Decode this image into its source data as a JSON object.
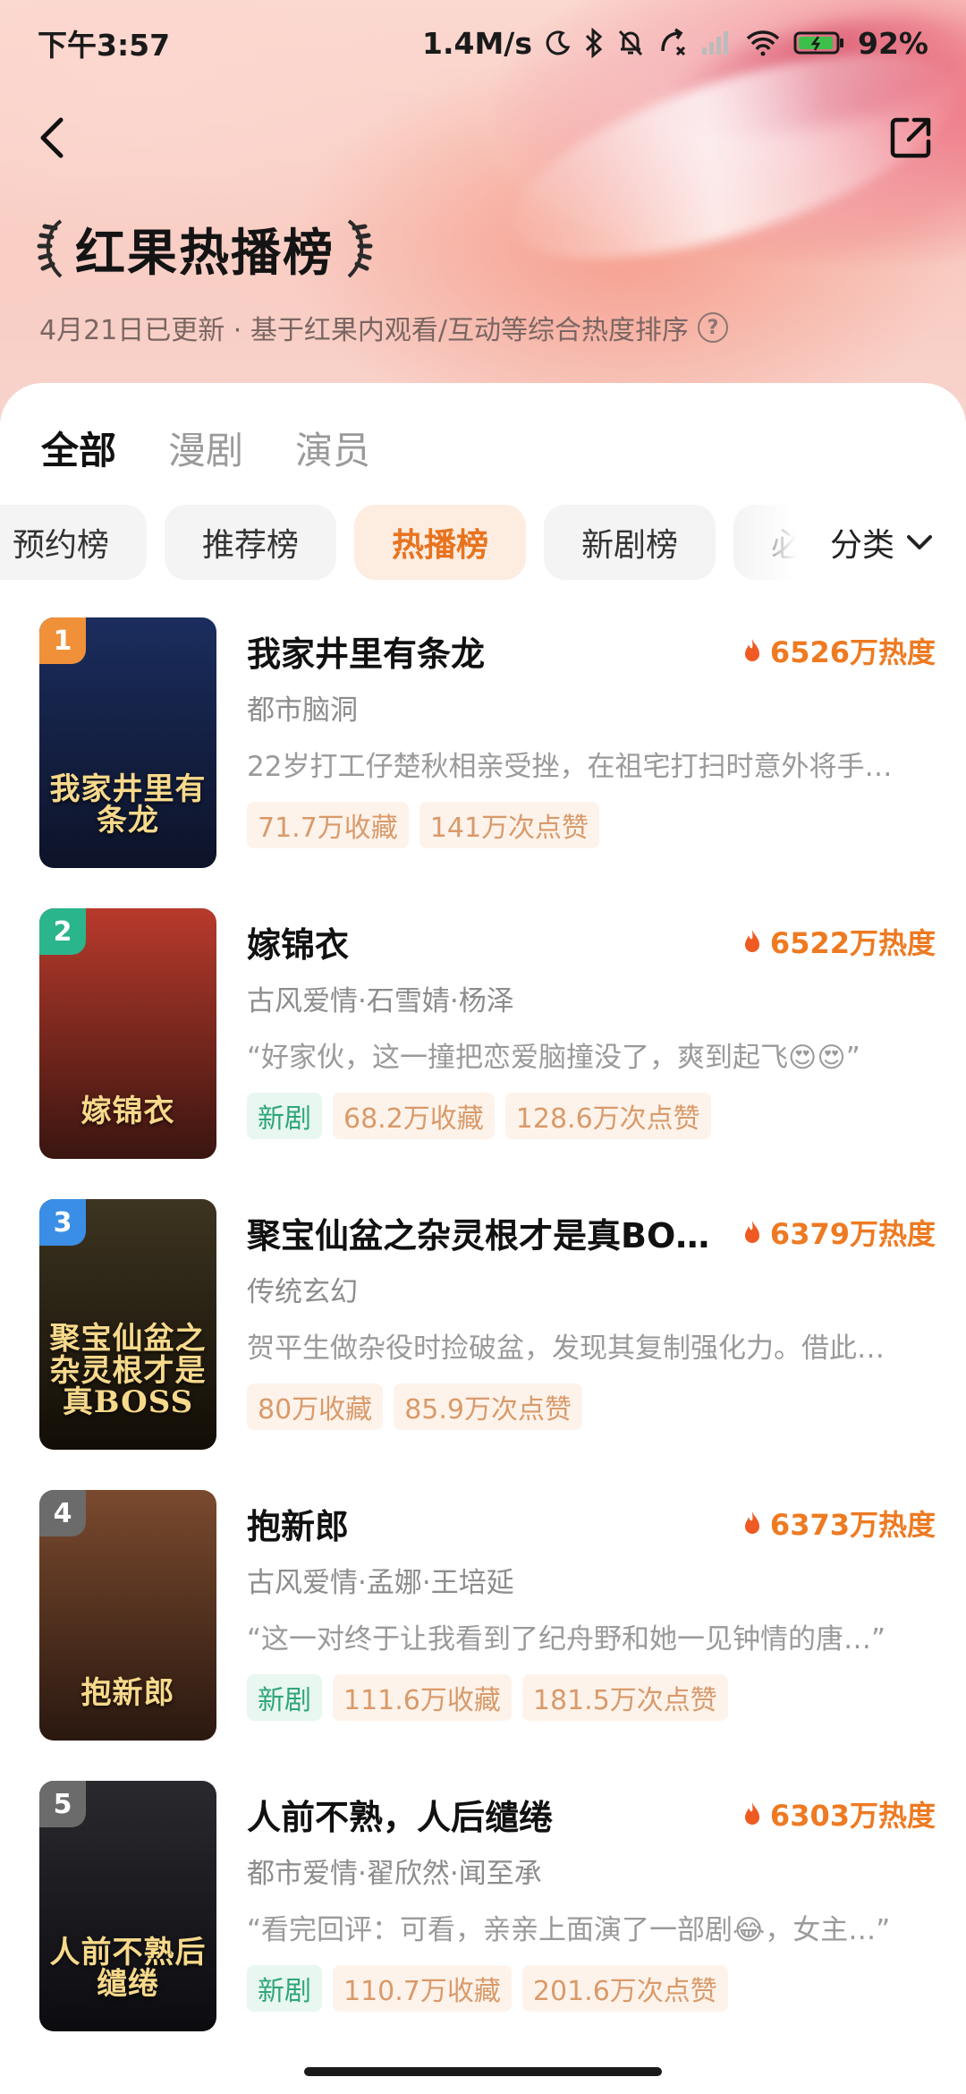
{
  "status_bar": {
    "time": "下午3:57",
    "net_speed": "1.4M/s",
    "battery": "92%"
  },
  "header": {
    "title": "红果热播榜",
    "subtitle": "4月21日已更新 · 基于红果内观看/互动等综合热度排序"
  },
  "tabs": [
    "全部",
    "漫剧",
    "演员"
  ],
  "active_tab": "全部",
  "chips": [
    "预约榜",
    "推荐榜",
    "热播榜",
    "新剧榜",
    "必"
  ],
  "active_chip": "热播榜",
  "category_label": "分类",
  "items": [
    {
      "rank": "1",
      "title": "我家井里有条龙",
      "heat": "6526万热度",
      "genre": "都市脑洞",
      "desc": "22岁打工仔楚秋相亲受挫，在祖宅打扫时意外将手…",
      "tags": [
        "71.7万收藏",
        "141万次点赞"
      ],
      "is_new": false,
      "new_label": "",
      "poster_text": "我家井里有条龙",
      "colors": {
        "rank": "#f0913a",
        "poster_top": "#1b2d5e",
        "poster_bottom": "#0d1328"
      }
    },
    {
      "rank": "2",
      "title": "嫁锦衣",
      "heat": "6522万热度",
      "genre": "古风爱情·石雪婧·杨泽",
      "desc": "“好家伙，这一撞把恋爱脑撞没了，爽到起飞😍😍”",
      "tags": [
        "68.2万收藏",
        "128.6万次点赞"
      ],
      "is_new": true,
      "new_label": "新剧",
      "poster_text": "嫁锦衣",
      "colors": {
        "rank": "#2ab58c",
        "poster_top": "#b83a2c",
        "poster_bottom": "#3a1510"
      }
    },
    {
      "rank": "3",
      "title": "聚宝仙盆之杂灵根才是真BOSS",
      "heat": "6379万热度",
      "genre": "传统玄幻",
      "desc": "贺平生做杂役时捡破盆，发现其复制强化力。借此…",
      "tags": [
        "80万收藏",
        "85.9万次点赞"
      ],
      "is_new": false,
      "new_label": "",
      "poster_text": "聚宝仙盆之杂灵根才是真BOSS",
      "colors": {
        "rank": "#3a8ee6",
        "poster_top": "#3d3420",
        "poster_bottom": "#120d06"
      }
    },
    {
      "rank": "4",
      "title": "抱新郎",
      "heat": "6373万热度",
      "genre": "古风爱情·孟娜·王培延",
      "desc": "“这一对终于让我看到了纪舟野和她一见钟情的唐…”",
      "tags": [
        "111.6万收藏",
        "181.5万次点赞"
      ],
      "is_new": true,
      "new_label": "新剧",
      "poster_text": "抱新郎",
      "colors": {
        "rank": "#6b6b6b",
        "poster_top": "#7a4a2e",
        "poster_bottom": "#2a1810"
      }
    },
    {
      "rank": "5",
      "title": "人前不熟，人后缱绻",
      "heat": "6303万热度",
      "genre": "都市爱情·翟欣然·闻至承",
      "desc": "“看完回评：可看，亲亲上面演了一部剧😂，女主…”",
      "tags": [
        "110.7万收藏",
        "201.6万次点赞"
      ],
      "is_new": true,
      "new_label": "新剧",
      "poster_text": "人前不熟后缱绻",
      "colors": {
        "rank": "#6b6b6b",
        "poster_top": "#2a2a2e",
        "poster_bottom": "#0c0c10"
      }
    }
  ],
  "icons": {
    "back": "chevron-left-icon",
    "share": "share-icon",
    "help": "question-icon",
    "flame": "flame-icon",
    "dropdown": "chevron-down-icon"
  },
  "accent_color": "#ee7a22"
}
